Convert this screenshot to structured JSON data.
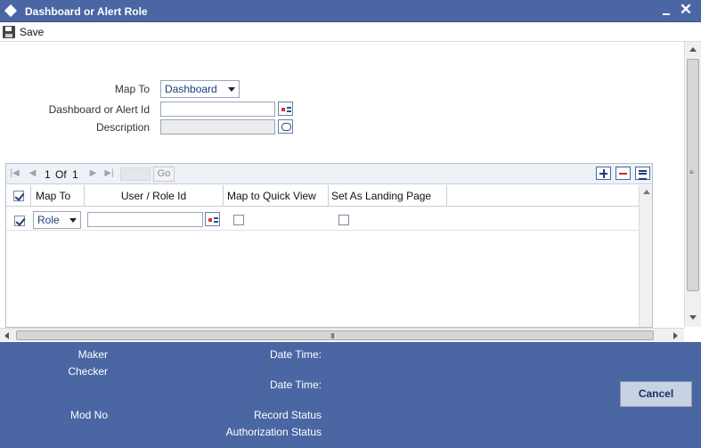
{
  "window": {
    "title": "Dashboard or Alert Role"
  },
  "toolbar": {
    "save_label": "Save"
  },
  "form": {
    "map_to_label": "Map To",
    "map_to_value": "Dashboard",
    "id_label": "Dashboard or Alert Id",
    "id_value": "",
    "description_label": "Description",
    "description_value": ""
  },
  "grid": {
    "pager": {
      "current": "1",
      "of_label": "Of",
      "total": "1",
      "go_label": "Go"
    },
    "columns": [
      "Map To",
      "User / Role Id",
      "Map to Quick View",
      "Set As Landing Page"
    ],
    "rows": [
      {
        "map_to": "Role",
        "user_role_id": "",
        "quick_view": false,
        "landing_page": false
      }
    ]
  },
  "footer": {
    "maker_label": "Maker",
    "checker_label": "Checker",
    "datetime1_label": "Date Time:",
    "datetime2_label": "Date Time:",
    "modno_label": "Mod No",
    "record_status_label": "Record Status",
    "auth_status_label": "Authorization Status",
    "cancel_label": "Cancel"
  },
  "colors": {
    "accent": "#4a66a3"
  }
}
